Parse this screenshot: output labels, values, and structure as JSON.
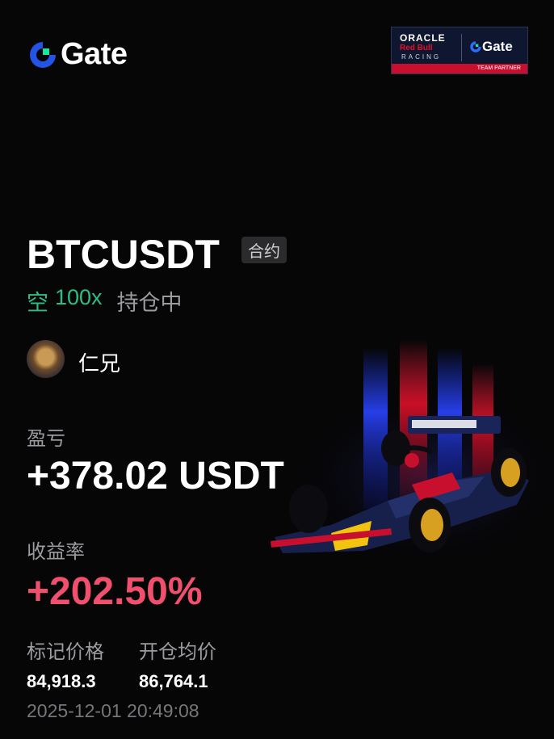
{
  "brand": {
    "name": "Gate"
  },
  "sponsor_badge": {
    "line1": "ORACLE",
    "line2": "Red Bull",
    "line3": "RACING",
    "partner_brand": "Gate",
    "footer": "TEAM PARTNER"
  },
  "position": {
    "symbol": "BTCUSDT",
    "type_tag": "合约",
    "side": "空",
    "leverage": "100x",
    "status": "持仓中"
  },
  "user": {
    "name": "仁兄"
  },
  "pnl": {
    "label": "盈亏",
    "value": "+378.02 USDT"
  },
  "roe": {
    "label": "收益率",
    "value": "+202.50%"
  },
  "prices": {
    "mark_label": "标记价格",
    "mark_value": "84,918.3",
    "entry_label": "开仓均价",
    "entry_value": "86,764.1"
  },
  "timestamp": "2025-12-01 20:49:08",
  "colors": {
    "long_green": "#2fbd85",
    "profit_red": "#f0506e",
    "gate_blue": "#2354e6",
    "gate_green": "#17e6a1"
  }
}
